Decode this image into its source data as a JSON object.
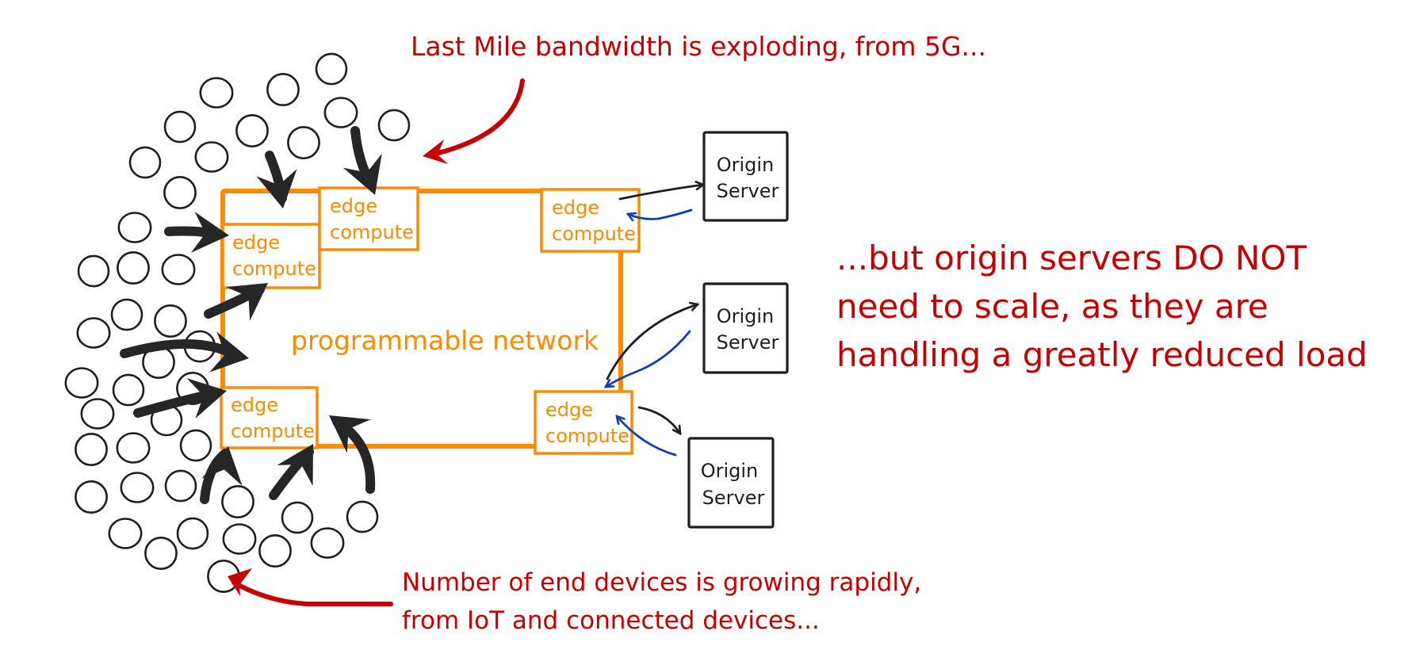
{
  "annotations": {
    "top": "Last Mile bandwidth is exploding, from 5G...",
    "right": [
      "...but origin servers DO NOT",
      "need to scale, as they are",
      "handling a greatly reduced load"
    ],
    "bottom": [
      "Number of end devices is growing rapidly,",
      "from IoT and connected devices..."
    ]
  },
  "network": {
    "label": "programmable network"
  },
  "edge_nodes": [
    {
      "line1": "edge",
      "line2": "compute"
    },
    {
      "line1": "edge",
      "line2": "compute"
    },
    {
      "line1": "edge",
      "line2": "compute"
    },
    {
      "line1": "edge",
      "line2": "compute"
    },
    {
      "line1": "edge",
      "line2": "compute"
    }
  ],
  "origin_servers": [
    {
      "line1": "Origin",
      "line2": "Server"
    },
    {
      "line1": "Origin",
      "line2": "Server"
    },
    {
      "line1": "Origin",
      "line2": "Server"
    }
  ],
  "colors": {
    "annotation": "#c60000",
    "network": "#ff8a00",
    "request_arrow": "#1e1e1e",
    "response_arrow": "#0d3fb0",
    "device": "#1e1e1e"
  },
  "end_device_count": 44
}
